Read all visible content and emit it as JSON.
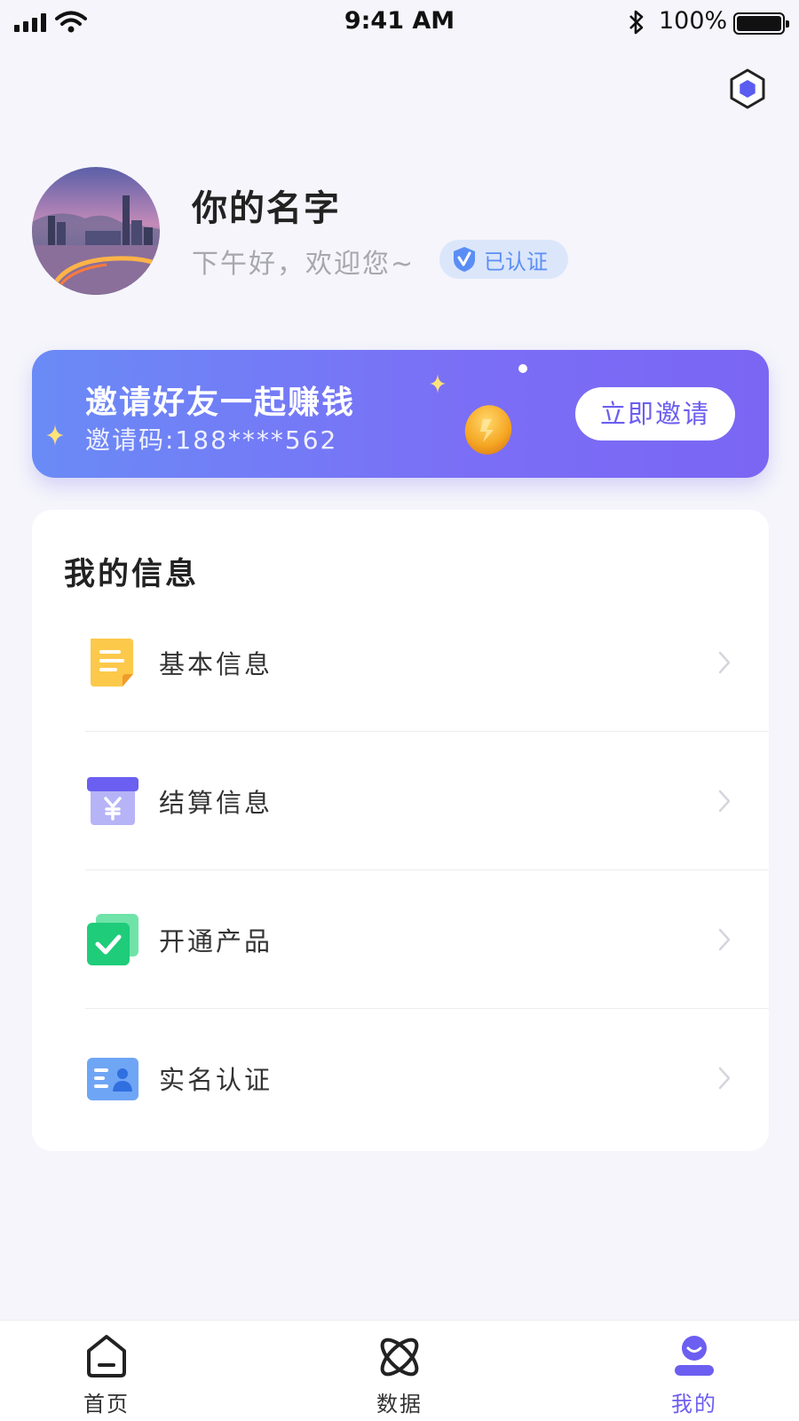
{
  "status_bar": {
    "time": "9:41 AM",
    "battery": "100%"
  },
  "profile": {
    "name": "你的名字",
    "greeting": "下午好，欢迎您~",
    "verified_label": "已认证"
  },
  "invite": {
    "title": "邀请好友一起赚钱",
    "code": "邀请码:188****562",
    "button": "立即邀请"
  },
  "info": {
    "title": "我的信息",
    "items": [
      {
        "label": "基本信息",
        "icon": "document-icon"
      },
      {
        "label": "结算信息",
        "icon": "yen-box-icon"
      },
      {
        "label": "开通产品",
        "icon": "checkbox-icon"
      },
      {
        "label": "实名认证",
        "icon": "id-card-icon"
      }
    ]
  },
  "tabs": [
    {
      "label": "首页",
      "icon": "home-icon"
    },
    {
      "label": "数据",
      "icon": "atom-icon"
    },
    {
      "label": "我的",
      "icon": "user-icon",
      "active": true
    }
  ],
  "colors": {
    "accent": "#6c5ef0",
    "background": "#f5f5fb",
    "banner_start": "#6a8bf6",
    "banner_end": "#7a66f3"
  }
}
